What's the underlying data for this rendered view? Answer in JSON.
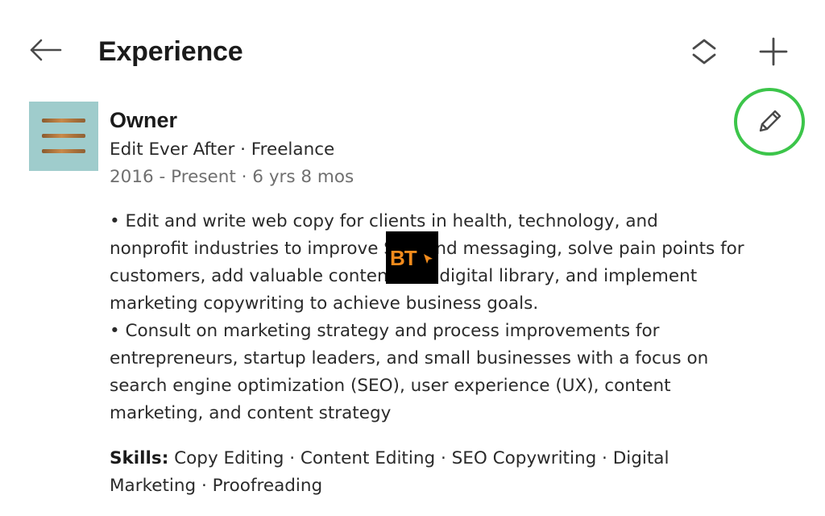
{
  "header": {
    "title": "Experience",
    "icons": {
      "back": "arrow-left-icon",
      "reorder": "reorder-chevrons-icon",
      "add": "plus-icon"
    }
  },
  "experience": {
    "logo_icon": "company-logo-lines",
    "role": "Owner",
    "company_line": "Edit Ever After · Freelance",
    "dates_line": "2016 - Present · 6 yrs 8 mos",
    "edit_icon": "pencil-icon",
    "edit_highlight_color": "#3cc54a",
    "description": {
      "para1_lines": [
        "• Edit and write web copy for clients in health, technology, and",
        "nonprofit industries to improve SEO and messaging, solve pain points for",
        "customers, add valuable content to a digital library, and implement",
        "marketing copywriting to achieve business goals."
      ],
      "para2_lines": [
        "• Consult on marketing strategy and process improvements for",
        "entrepreneurs, startup leaders, and small businesses with a focus on",
        "search engine optimization (SEO), user experience (UX), content",
        "marketing, and content strategy"
      ]
    },
    "skills": {
      "label": "Skills:",
      "line1": " Copy Editing · Content Editing · SEO Copywriting · Digital",
      "line2": "Marketing · Proofreading"
    }
  },
  "watermark": {
    "text": "BT"
  }
}
